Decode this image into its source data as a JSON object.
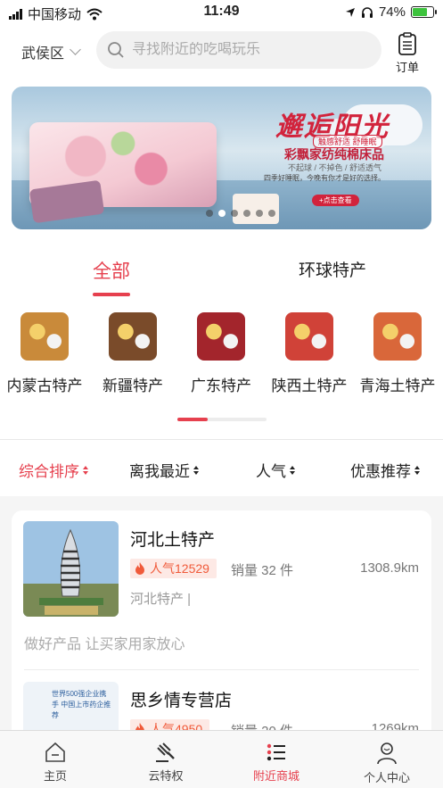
{
  "status_bar": {
    "carrier": "中国移动",
    "time": "11:49",
    "battery": "74%",
    "battery_level": 0.74
  },
  "header": {
    "district": "武侯区",
    "search_placeholder": "寻找附近的吃喝玩乐",
    "orders_label": "订单"
  },
  "banner": {
    "title": "邂逅阳光",
    "tag": "触感舒适 舒睡眠",
    "subtitle": "彩飘家纺纯棉床品",
    "line1": "不起球 / 不掉色 / 舒适透气",
    "line2": "四季好睡眠，今晚有你才是好的选择。",
    "cta": "+点击查看",
    "slides": 6,
    "active_slide": 1
  },
  "category_tabs": [
    {
      "label": "全部",
      "active": true
    },
    {
      "label": "环球特产",
      "active": false
    }
  ],
  "products": [
    {
      "name": "内蒙古特产",
      "color": "#c98a3a"
    },
    {
      "name": "新疆特产",
      "color": "#7a4b2a"
    },
    {
      "name": "广东特产",
      "color": "#a3252c"
    },
    {
      "name": "陕西土特产",
      "color": "#d04238"
    },
    {
      "name": "青海土特产",
      "color": "#d9673a"
    }
  ],
  "sort_bar": [
    {
      "label": "综合排序",
      "active": true
    },
    {
      "label": "离我最近",
      "active": false
    },
    {
      "label": "人气",
      "active": false
    },
    {
      "label": "优惠推荐",
      "active": false
    }
  ],
  "shops": [
    {
      "name": "河北土特产",
      "popularity": "人气12529",
      "sales": "销量 32 件",
      "distance": "1308.9km",
      "category": "河北特产 |",
      "slogan": "做好产品 让买家用家放心",
      "image_caption": ""
    },
    {
      "name": "思乡情专营店",
      "popularity": "人气4950",
      "sales": "销量 20 件",
      "distance": "1269km",
      "category": "",
      "slogan": "",
      "image_caption": "世界500强企业携手 中国上市药企推荐"
    }
  ],
  "tabbar": [
    {
      "label": "主页",
      "icon": "home-icon",
      "active": false
    },
    {
      "label": "云特权",
      "icon": "gavel-icon",
      "active": false
    },
    {
      "label": "附近商城",
      "icon": "list-icon",
      "active": true
    },
    {
      "label": "个人中心",
      "icon": "person-icon",
      "active": false
    }
  ],
  "colors": {
    "accent": "#e6404e",
    "popularity_bg": "#fde9e5",
    "popularity_text": "#f05a3a"
  }
}
